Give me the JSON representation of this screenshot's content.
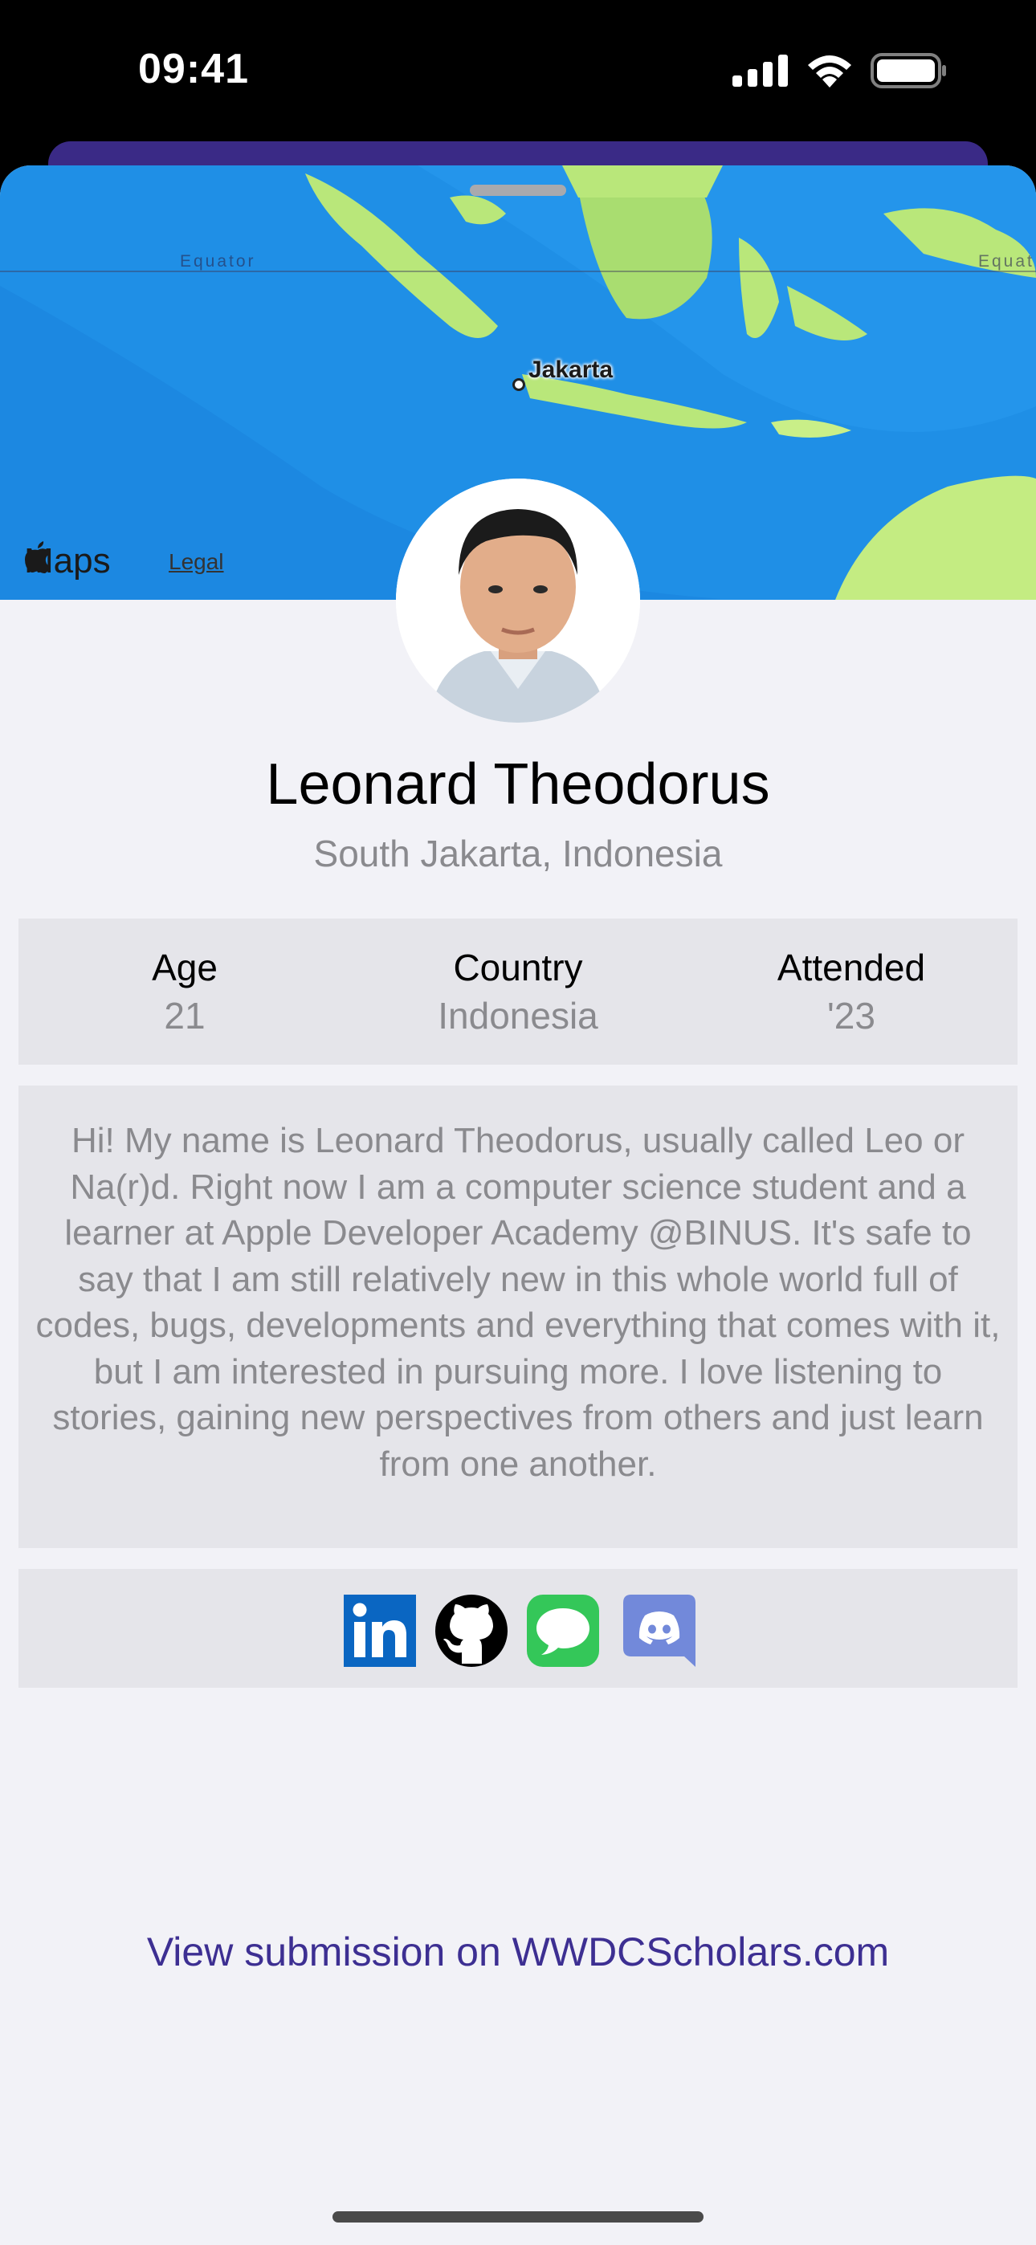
{
  "status_bar": {
    "time": "09:41",
    "signal_icon": "cellular-signal-icon",
    "wifi_icon": "wifi-icon",
    "battery_icon": "battery-icon"
  },
  "map": {
    "equator_label": "Equator",
    "equator_label_right": "Equat",
    "city": "Jakarta",
    "brand": "Maps",
    "brand_icon": "apple-logo-icon",
    "legal": "Legal"
  },
  "profile": {
    "name": "Leonard Theodorus",
    "location": "South Jakarta, Indonesia"
  },
  "stats": [
    {
      "label": "Age",
      "value": "21"
    },
    {
      "label": "Country",
      "value": "Indonesia"
    },
    {
      "label": "Attended",
      "value": "'23"
    }
  ],
  "bio": "Hi! My name is Leonard Theodorus, usually called Leo or Na(r)d. Right now I am a computer science student and a learner at Apple Developer Academy @BINUS. It's safe to say that I am still relatively new in this whole world full of codes, bugs, developments and everything that comes with it, but I am interested in pursuing more. I love listening to stories, gaining new perspectives from others and just learn from one another.",
  "socials": [
    {
      "name": "linkedin-icon",
      "color": "#0a66c2"
    },
    {
      "name": "github-icon",
      "color": "#000000"
    },
    {
      "name": "messages-icon",
      "color": "#34c759"
    },
    {
      "name": "discord-icon",
      "color": "#7289da"
    }
  ],
  "submission_link": "View submission on WWDCScholars.com",
  "colors": {
    "accent": "#3d2f92",
    "card": "#e5e5ea",
    "background": "#f2f2f7"
  }
}
